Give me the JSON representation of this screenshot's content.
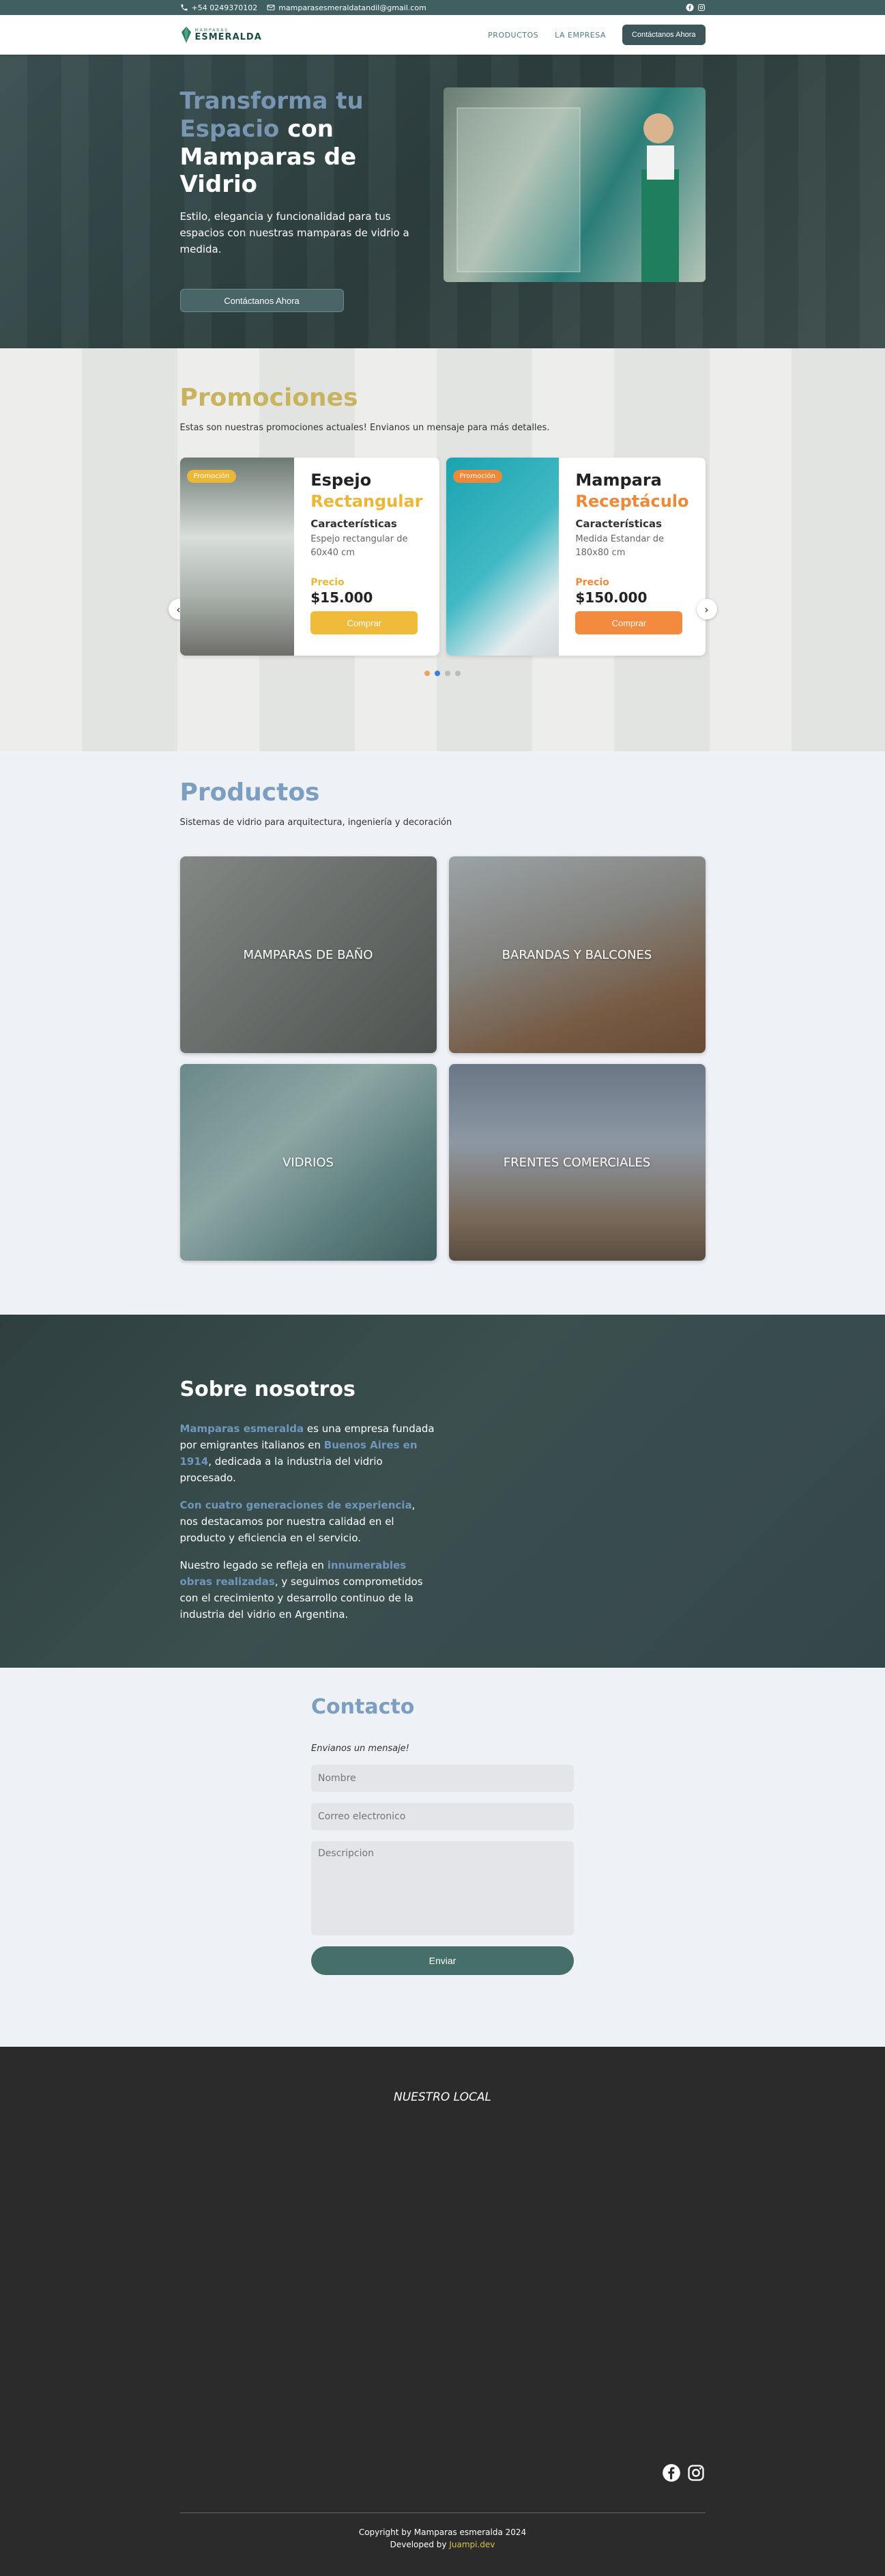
{
  "topbar": {
    "phone": "+54 0249370102",
    "email": "mamparasesmeraldatandil@gmail.com",
    "social": [
      "facebook-icon",
      "instagram-icon"
    ]
  },
  "nav": {
    "logo_small": "MAMPARAS",
    "logo_big": "ESMERALDA",
    "links": [
      "PRODUCTOS",
      "LA EMPRESA"
    ],
    "cta": "Contáctanos Ahora"
  },
  "hero": {
    "title_accent": "Transforma tu Espacio",
    "title_rest": "con Mamparas de Vidrio",
    "subtitle": "Estilo, elegancia y funcionalidad para tus espacios con nuestras mamparas de vidrio a medida.",
    "button": "Contáctanos Ahora"
  },
  "promos": {
    "title": "Promociones",
    "description": "Estas son nuestras promociones actuales! Envianos un mensaje para más detalles.",
    "cards": [
      {
        "badge": "Promoción",
        "title_1": "Espejo",
        "title_2": "Rectangular",
        "features_label": "Características",
        "description": "Espejo rectangular de 60x40 cm",
        "price_label": "Precio",
        "price": "$15.000",
        "buy": "Comprar",
        "accent": "#ecb736"
      },
      {
        "badge": "Promoción",
        "title_1": "Mampara",
        "title_2": "Receptáculo",
        "features_label": "Características",
        "description": "Medida Estandar de 180x80 cm",
        "price_label": "Precio",
        "price": "$150.000",
        "buy": "Comprar",
        "accent": "#f08839"
      }
    ],
    "dots": 4,
    "active_dot": 2
  },
  "products": {
    "title": "Productos",
    "description": "Sistemas de vidrio para arquitectura, ingeniería y decoración",
    "items": [
      "MAMPARAS DE BAÑO",
      "BARANDAS Y BALCONES",
      "VIDRIOS",
      "FRENTES COMERCIALES"
    ]
  },
  "about": {
    "title": "Sobre nosotros",
    "p1_hl1": "Mamparas esmeralda",
    "p1_t1": " es una empresa fundada por emigrantes italianos en ",
    "p1_hl2": "Buenos Aires en 1914",
    "p1_t2": ", dedicada a la industria del vidrio procesado.",
    "p2_hl": "Con cuatro generaciones de experiencia",
    "p2_t": ", nos destacamos por nuestra calidad en el producto y eficiencia en el servicio.",
    "p3_t1": "Nuestro legado se refleja en ",
    "p3_hl": "innumerables obras realizadas",
    "p3_t2": ", y seguimos comprometidos con el crecimiento y desarrollo continuo de la industria del vidrio en Argentina."
  },
  "contact": {
    "title": "Contacto",
    "note": "Envianos un mensaje!",
    "name_placeholder": "Nombre",
    "email_placeholder": "Correo electronico",
    "desc_placeholder": "Descripcion",
    "send": "Enviar"
  },
  "footer": {
    "local": "NUESTRO LOCAL",
    "copyright": "Copyright by Mamparas esmeralda 2024",
    "developed_prefix": "Developed by ",
    "developer": "Juampi.dev"
  },
  "colors": {
    "topbar": "#3f5f60",
    "accent_blue": "#7c9ec0",
    "gold": "#ecb736",
    "orange": "#f08839",
    "footer": "#2b2b2b"
  }
}
